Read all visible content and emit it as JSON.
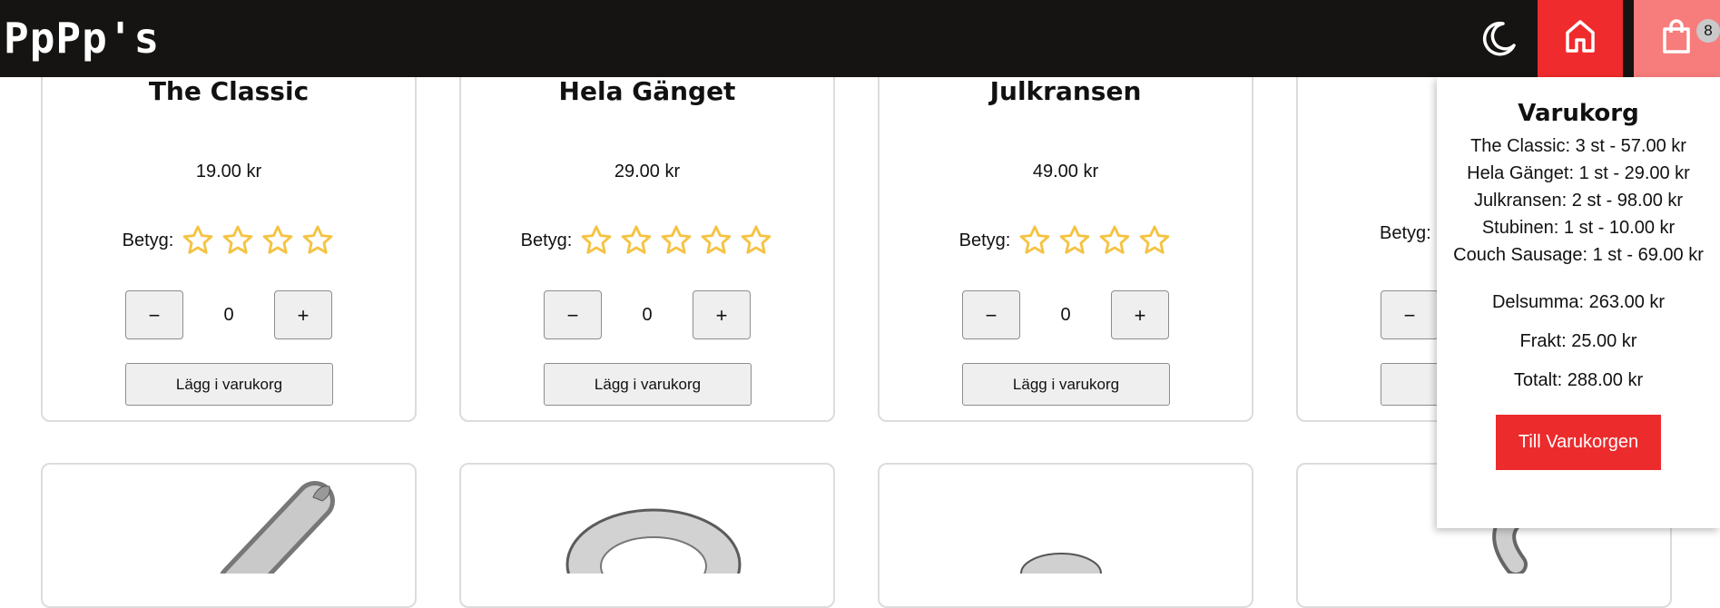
{
  "header": {
    "logo": "PpPp's",
    "theme_toggle_icon": "moon-icon",
    "home_icon": "home-icon",
    "cart_icon": "shopping-bag-icon",
    "cart_count": "8",
    "colors": {
      "header_bg": "#151413",
      "home_bg": "#ef2b2d",
      "cart_bg": "#f77c7c"
    }
  },
  "products": [
    {
      "title": "The Classic",
      "price": "19.00 kr",
      "rating_label": "Betyg:",
      "stars": 4,
      "quantity": "0",
      "minus": "−",
      "plus": "+",
      "add_label": "Lägg i varukorg"
    },
    {
      "title": "Hela Gänget",
      "price": "29.00 kr",
      "rating_label": "Betyg:",
      "stars": 5,
      "quantity": "0",
      "minus": "−",
      "plus": "+",
      "add_label": "Lägg i varukorg"
    },
    {
      "title": "Julkransen",
      "price": "49.00 kr",
      "rating_label": "Betyg:",
      "stars": 4,
      "quantity": "0",
      "minus": "−",
      "plus": "+",
      "add_label": "Lägg i varukorg"
    },
    {
      "title": "",
      "price": "",
      "rating_label": "Betyg:",
      "stars": 0,
      "quantity": "",
      "minus": "−",
      "plus": "+",
      "add_label": "L"
    }
  ],
  "cart": {
    "title": "Varukorg",
    "items": [
      "The Classic: 3 st - 57.00 kr",
      "Hela Gänget: 1 st - 29.00 kr",
      "Julkransen: 2 st - 98.00 kr",
      "Stubinen: 1 st - 10.00 kr",
      "Couch Sausage: 1 st - 69.00 kr"
    ],
    "subtotal": "Delsumma: 263.00 kr",
    "shipping": "Frakt: 25.00 kr",
    "total": "Totalt: 288.00 kr",
    "checkout_label": "Till Varukorgen",
    "accent_color": "#ec2b2d"
  },
  "star_color": "#f5c342"
}
